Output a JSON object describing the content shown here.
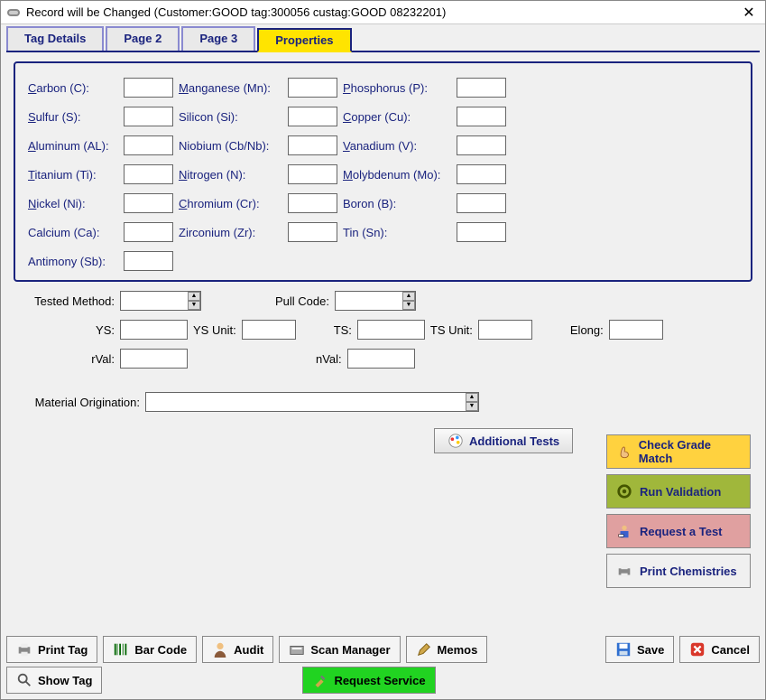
{
  "window": {
    "title": "Record will be Changed  (Customer:GOOD   tag:300056 custag:GOOD 08232201)"
  },
  "tabs": {
    "t0": "Tag Details",
    "t1": "Page 2",
    "t2": "Page 3",
    "t3": "Properties"
  },
  "chem": {
    "carbon": "Carbon (C):",
    "v_carbon": "",
    "manganese": "Manganese (Mn):",
    "v_manganese": "",
    "phosphorus": "Phosphorus (P):",
    "v_phosphorus": "",
    "sulfur": "Sulfur (S):",
    "v_sulfur": "",
    "silicon": "Silicon (Si):",
    "v_silicon": "",
    "copper": "Copper (Cu):",
    "v_copper": "",
    "aluminum": "Aluminum (AL):",
    "v_aluminum": "",
    "niobium": "Niobium (Cb/Nb):",
    "v_niobium": "",
    "vanadium": "Vanadium (V):",
    "v_vanadium": "",
    "titanium": "Titanium (Ti):",
    "v_titanium": "",
    "nitrogen": "Nitrogen (N):",
    "v_nitrogen": "",
    "molybdenum": "Molybdenum (Mo):",
    "v_molybdenum": "",
    "nickel": "Nickel (Ni):",
    "v_nickel": "",
    "chromium": "Chromium (Cr):",
    "v_chromium": "",
    "boron": "Boron (B):",
    "v_boron": "",
    "calcium": "Calcium (Ca):",
    "v_calcium": "",
    "zirconium": "Zirconium (Zr):",
    "v_zirconium": "",
    "tin": "Tin (Sn):",
    "v_tin": "",
    "antimony": "Antimony (Sb):",
    "v_antimony": ""
  },
  "tests": {
    "tested_method_label": "Tested Method:",
    "tested_method": "",
    "pull_code_label": "Pull Code:",
    "pull_code": "",
    "ys_label": "YS:",
    "ys": "",
    "ys_unit_label": "YS Unit:",
    "ys_unit": "",
    "ts_label": "TS:",
    "ts": "",
    "ts_unit_label": "TS Unit:",
    "ts_unit": "",
    "elong_label": "Elong:",
    "elong": "",
    "rval_label": "rVal:",
    "rval": "",
    "nval_label": "nVal:",
    "nval": "",
    "mat_orig_label": "Material Origination:",
    "mat_orig": "",
    "additional_tests": "Additional Tests"
  },
  "side": {
    "check_grade": "Check Grade Match",
    "run_validation": "Run Validation",
    "request_test": "Request a Test",
    "print_chem": "Print Chemistries"
  },
  "footer": {
    "print_tag": "Print Tag",
    "bar_code": "Bar Code",
    "audit": "Audit",
    "scan_manager": "Scan Manager",
    "memos": "Memos",
    "save": "Save",
    "cancel": "Cancel",
    "show_tag": "Show Tag",
    "request_service": "Request Service"
  }
}
